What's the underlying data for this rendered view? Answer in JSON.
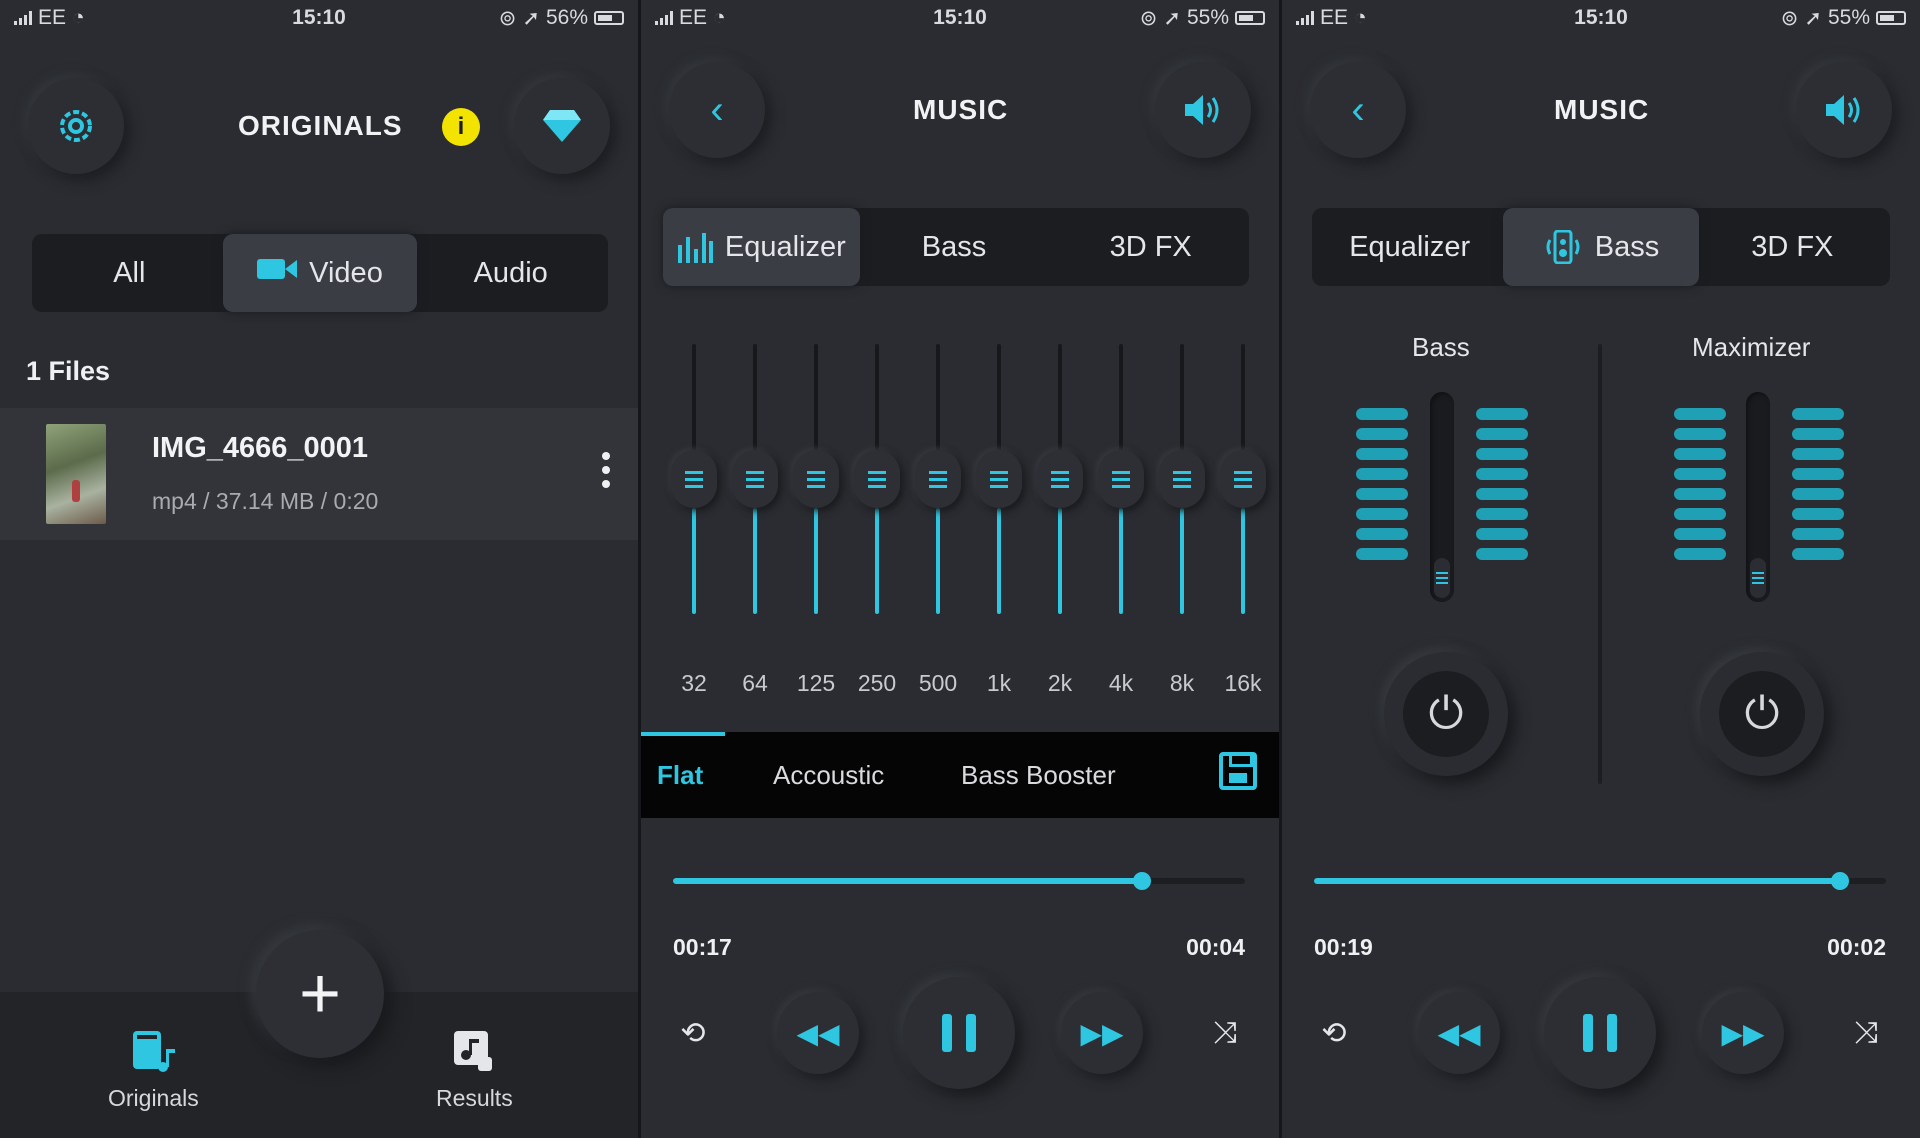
{
  "status": [
    {
      "carrier": "EE",
      "time": "15:10",
      "battery": "56%"
    },
    {
      "carrier": "EE",
      "time": "15:10",
      "battery": "55%"
    },
    {
      "carrier": "EE",
      "time": "15:10",
      "battery": "55%"
    }
  ],
  "originals": {
    "title": "ORIGINALS",
    "tabs": {
      "all": "All",
      "video": "Video",
      "audio": "Audio"
    },
    "files_count": "1 Files",
    "file": {
      "name": "IMG_4666_0001",
      "meta": "mp4 / 37.14 MB / 0:20"
    },
    "nav": {
      "originals": "Originals",
      "results": "Results"
    },
    "fab": "+"
  },
  "music_eq": {
    "title": "MUSIC",
    "tabs": {
      "equalizer": "Equalizer",
      "bass": "Bass",
      "fx": "3D FX"
    },
    "bands": [
      "32",
      "64",
      "125",
      "250",
      "500",
      "1k",
      "2k",
      "4k",
      "8k",
      "16k"
    ],
    "band_levels": [
      0.5,
      0.5,
      0.5,
      0.5,
      0.5,
      0.5,
      0.5,
      0.5,
      0.5,
      0.5
    ],
    "presets": {
      "flat": "Flat",
      "acoustic": "Accoustic",
      "bass_booster": "Bass Booster"
    },
    "elapsed": "00:17",
    "remaining": "00:04",
    "progress": 0.82
  },
  "music_bass": {
    "title": "MUSIC",
    "tabs": {
      "equalizer": "Equalizer",
      "bass": "Bass",
      "fx": "3D FX"
    },
    "bass_label": "Bass",
    "maximizer_label": "Maximizer",
    "elapsed": "00:19",
    "remaining": "00:02",
    "progress": 0.92
  },
  "colors": {
    "accent": "#2ec6e0",
    "info_badge": "#f2e400",
    "background": "#2a2c31"
  },
  "icons": {
    "settings": "gear-icon",
    "info": "info-icon",
    "premium": "diamond-icon",
    "back": "chevron-left-icon",
    "volume": "volume-icon",
    "repeat": "repeat-icon",
    "rewind": "rewind-icon",
    "pause": "pause-icon",
    "forward": "fast-forward-icon",
    "shuffle": "shuffle-icon"
  }
}
